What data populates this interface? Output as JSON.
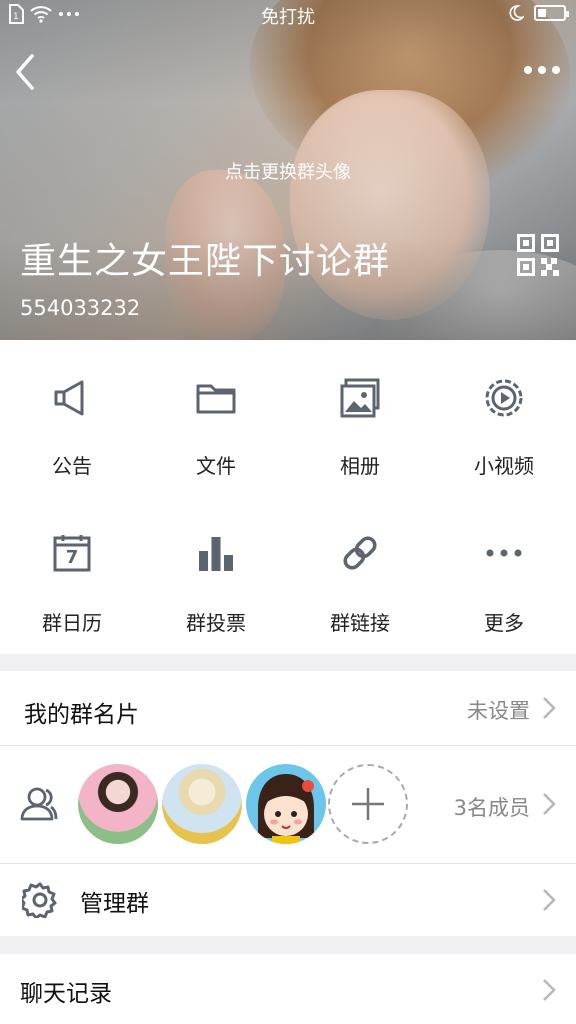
{
  "status_bar": {
    "center_text": "免打扰"
  },
  "header": {
    "change_avatar_hint": "点击更换群头像",
    "group_name": "重生之女王陛下讨论群",
    "group_id": "554033232"
  },
  "features": [
    {
      "label": "公告",
      "icon": "megaphone-icon"
    },
    {
      "label": "文件",
      "icon": "folder-icon"
    },
    {
      "label": "相册",
      "icon": "photo-album-icon"
    },
    {
      "label": "小视频",
      "icon": "video-play-icon"
    },
    {
      "label": "群日历",
      "icon": "calendar-icon"
    },
    {
      "label": "群投票",
      "icon": "bar-chart-icon"
    },
    {
      "label": "群链接",
      "icon": "link-icon"
    },
    {
      "label": "更多",
      "icon": "more-dots-icon"
    }
  ],
  "calendar_day": "7",
  "my_card": {
    "label": "我的群名片",
    "value": "未设置"
  },
  "members": {
    "count_label": "3名成员"
  },
  "manage": {
    "label": "管理群"
  },
  "chat_history": {
    "label": "聊天记录"
  },
  "colors": {
    "icon_gray": "#5c6470",
    "chevron": "#b8b8bc",
    "secondary_text": "#888888"
  }
}
